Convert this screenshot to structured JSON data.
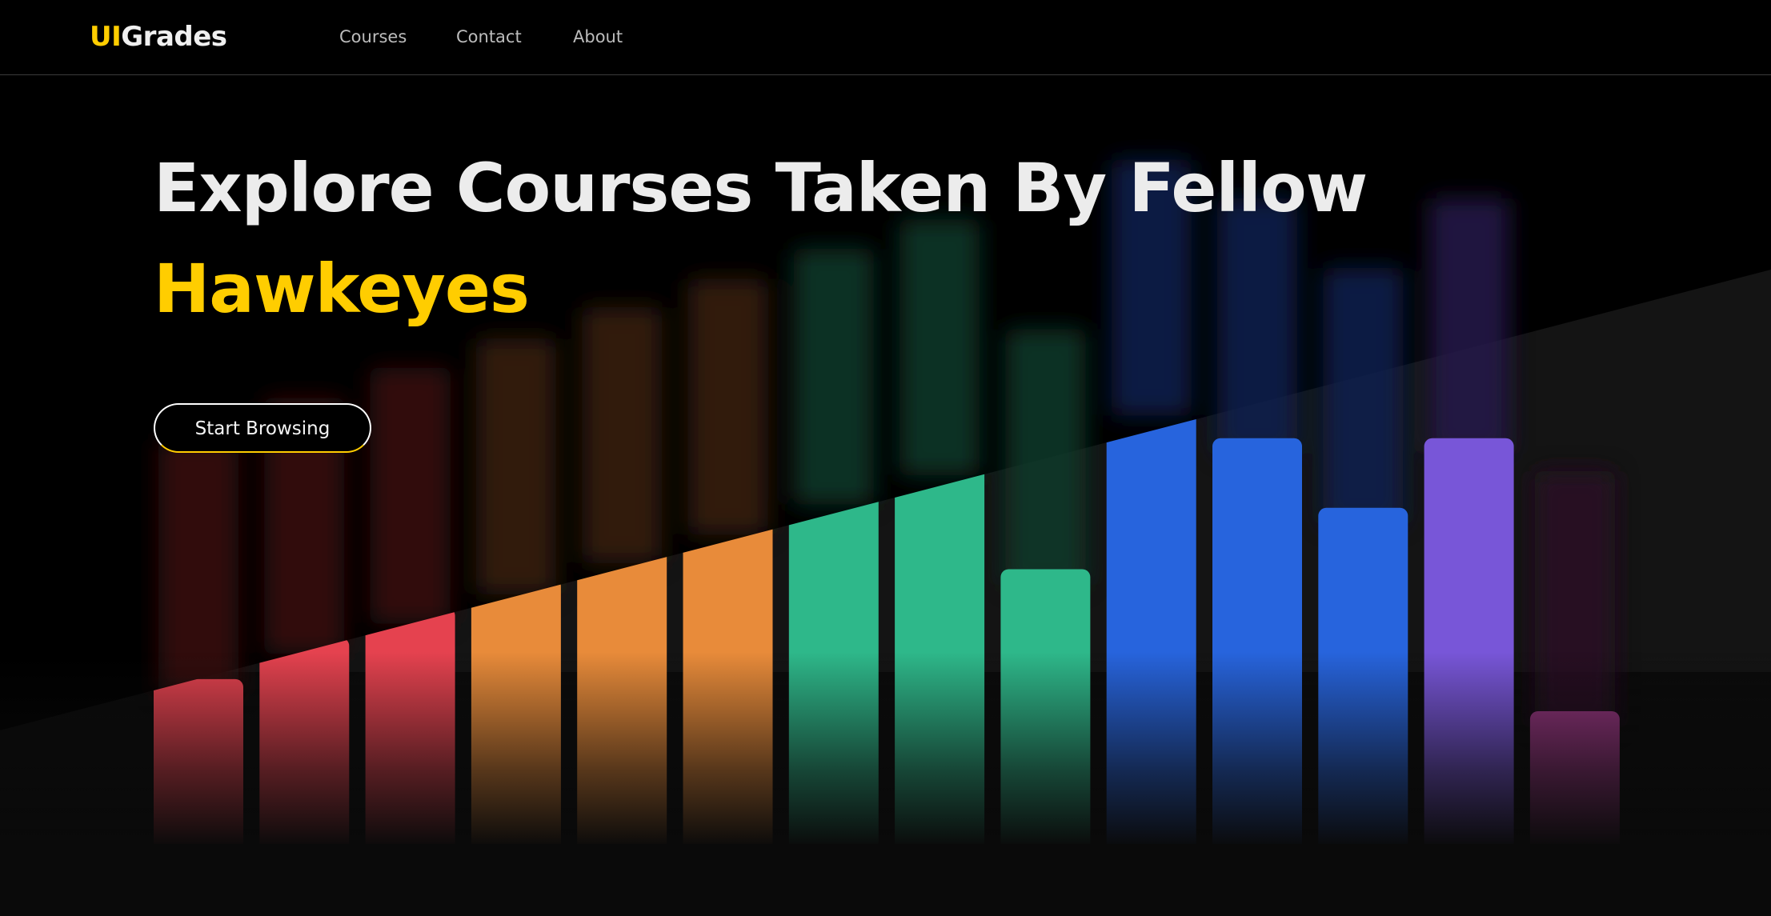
{
  "nav": {
    "logo_accent": "UI",
    "logo_text": "Grades",
    "links": [
      "Courses",
      "Contact",
      "About"
    ]
  },
  "hero": {
    "line1": "Explore Courses Taken By Fellow",
    "line2": "Hawkeyes",
    "cta": "Start Browsing"
  },
  "colors": {
    "accent": "#FFCD00",
    "background": "#000000",
    "red": "#E5424F",
    "orange": "#E88B3A",
    "green": "#2EB88A",
    "blue": "#2764DD",
    "purple": "#7856D8",
    "magenta": "#94347E"
  },
  "grade_bars": [
    {
      "color": "red",
      "level": 0.18
    },
    {
      "color": "red",
      "level": 0.225
    },
    {
      "color": "red",
      "level": 0.258
    },
    {
      "color": "orange",
      "level": 0.29
    },
    {
      "color": "orange",
      "level": 0.324
    },
    {
      "color": "orange",
      "level": 0.355
    },
    {
      "color": "green",
      "level": 0.388
    },
    {
      "color": "green",
      "level": 0.42
    },
    {
      "color": "green",
      "level": 0.3
    },
    {
      "color": "blue",
      "level": 0.485
    },
    {
      "color": "blue",
      "level": 0.443
    },
    {
      "color": "blue",
      "level": 0.367
    },
    {
      "color": "purple",
      "level": 0.443
    },
    {
      "color": "magenta",
      "level": 0.145
    }
  ]
}
